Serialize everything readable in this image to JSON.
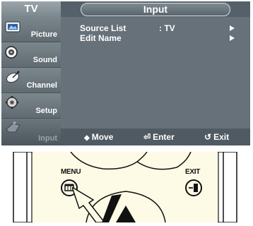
{
  "osd": {
    "tv_label": "TV",
    "title": "Input",
    "sidebar": [
      {
        "label": "Picture",
        "icon": "picture-icon",
        "active": false
      },
      {
        "label": "Sound",
        "icon": "sound-icon",
        "active": false
      },
      {
        "label": "Channel",
        "icon": "channel-icon",
        "active": false
      },
      {
        "label": "Setup",
        "icon": "setup-icon",
        "active": false
      },
      {
        "label": "Input",
        "icon": "input-icon",
        "active": true
      }
    ],
    "menu_rows": [
      {
        "label": "Source List",
        "value": ": TV"
      },
      {
        "label": "Edit Name",
        "value": ""
      }
    ],
    "footer": {
      "move_glyph": "◆",
      "move": "Move",
      "enter_glyph": "⏎",
      "enter": "Enter",
      "exit_glyph": "↺",
      "exit": "Exit"
    }
  },
  "remote": {
    "menu_label": "MENU",
    "exit_label": "EXIT"
  },
  "colors": {
    "osd_bg": "#66717a",
    "sidebar_bg": "#5c676f",
    "remote_body": "#fdfbe6"
  }
}
